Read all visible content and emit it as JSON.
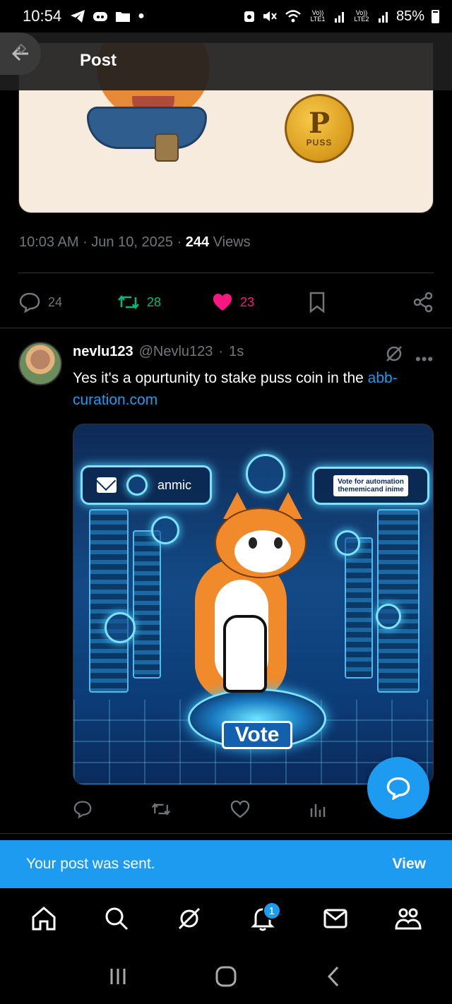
{
  "status_bar": {
    "time": "10:54",
    "signal1_label": "Vo)) LTE1",
    "signal2_label": "Vo)) LTE2",
    "battery": "85%"
  },
  "header": {
    "title": "Post",
    "back_icon": "arrow-left-icon"
  },
  "top_image": {
    "coin_text": "PUSS"
  },
  "post_meta": {
    "time": "10:03 AM",
    "date": "Jun 10, 2025",
    "views_count": "244",
    "views_label": "Views"
  },
  "post_actions": {
    "replies": "24",
    "reposts": "28",
    "likes": "23",
    "colors": {
      "repost": "#00ba7c",
      "like": "#f91880"
    }
  },
  "reply": {
    "name": "nevlu123",
    "handle": "@Nevlu123",
    "time": "1s",
    "text": "Yes it's a opurtunity to stake puss coin in the ",
    "link_text": "abb-curation.com",
    "image": {
      "panel_left_text": "anmic",
      "panel_right_line1": "Vote for automation",
      "panel_right_line2": "thememicand inime",
      "vote_label": "Vote"
    }
  },
  "toast": {
    "message": "Your post was sent.",
    "action": "View"
  },
  "bottom_nav": {
    "items": [
      "home-icon",
      "search-icon",
      "grok-icon",
      "notifications-icon",
      "messages-icon",
      "communities-icon"
    ],
    "notification_badge": "1"
  },
  "accent_color": "#1d9bf0"
}
